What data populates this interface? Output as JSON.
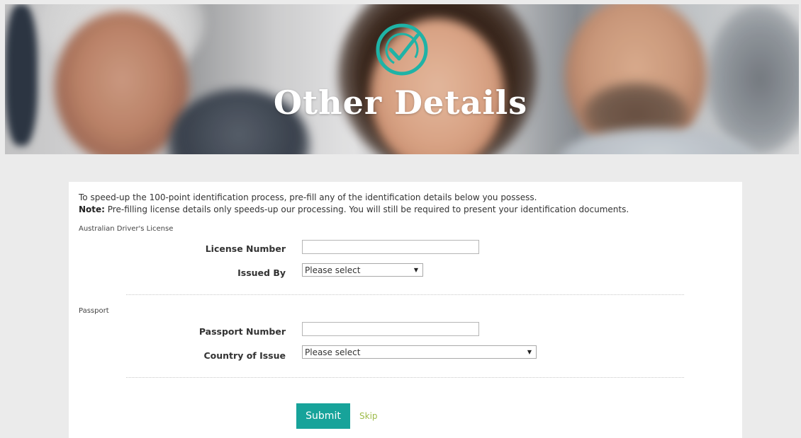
{
  "hero": {
    "title": "Other Details"
  },
  "form": {
    "intro_text": "To speed-up the 100-point identification process, pre-fill any of the identification details below you possess.",
    "note_label": "Note:",
    "note_text": " Pre-filling license details only speeds-up our processing. You will still be required to present your identification documents.",
    "license_section": {
      "label": "Australian Driver's License",
      "license_number_label": "License Number",
      "license_number_value": "",
      "issued_by_label": "Issued By",
      "issued_by_selected": "Please select"
    },
    "passport_section": {
      "label": "Passport",
      "passport_number_label": "Passport Number",
      "passport_number_value": "",
      "country_label": "Country of Issue",
      "country_selected": "Please select"
    },
    "submit_label": "Submit",
    "skip_label": "Skip"
  },
  "colors": {
    "accent": "#17a39a",
    "skip_link": "#9dbb49",
    "page_background": "#ebebeb"
  },
  "icons": {
    "logo": "check-circle-icon",
    "dropdown": "chevron-down-icon"
  }
}
